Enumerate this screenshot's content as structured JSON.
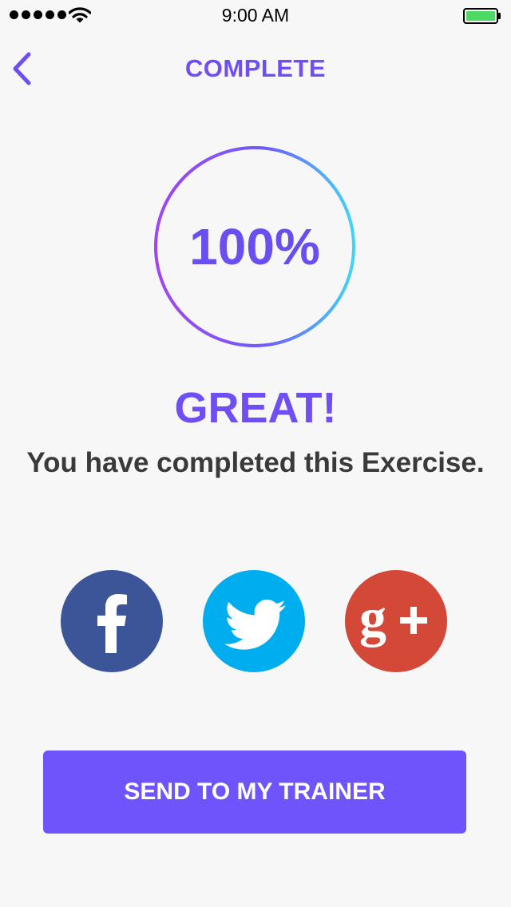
{
  "status_bar": {
    "time": "9:00 AM"
  },
  "nav": {
    "title": "COMPLETE",
    "back_icon": "chevron-left-icon"
  },
  "progress": {
    "value": 1.0,
    "label": "100%"
  },
  "result": {
    "headline": "GREAT!",
    "message": "You have completed this Exercise."
  },
  "share": {
    "items": [
      {
        "network": "facebook",
        "icon": "facebook-icon",
        "color": "#3b5598"
      },
      {
        "network": "twitter",
        "icon": "twitter-icon",
        "color": "#00adef"
      },
      {
        "network": "google-plus",
        "icon": "google-plus-icon",
        "color": "#d34836"
      }
    ]
  },
  "actions": {
    "send_label": "SEND TO MY TRAINER"
  },
  "colors": {
    "accent": "#6f4ef5",
    "ring_start": "#a145f3",
    "ring_end": "#42d4f8"
  }
}
